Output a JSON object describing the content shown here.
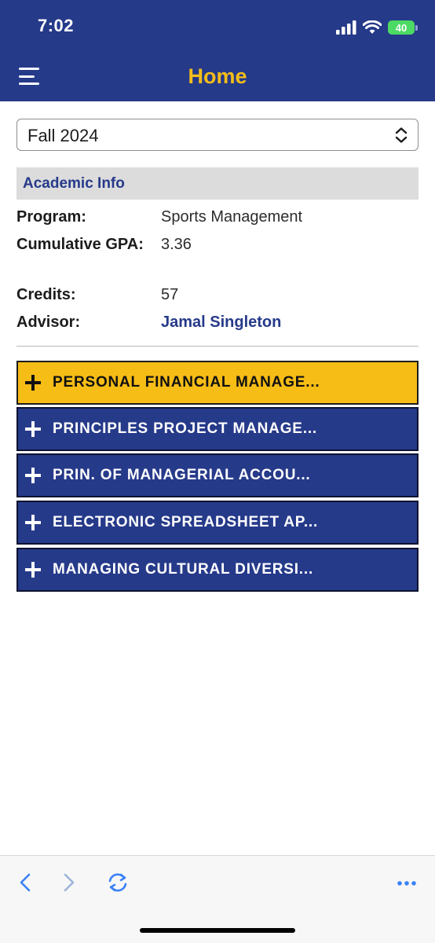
{
  "status_bar": {
    "time": "7:02",
    "battery": "40"
  },
  "header": {
    "title": "Home",
    "menu_icon": "hamburger-menu-icon"
  },
  "term_select": {
    "selected": "Fall 2024",
    "icon": "up-down-chevron-icon"
  },
  "academic_info": {
    "heading": "Academic Info",
    "rows": [
      {
        "label": "Program:",
        "value": "Sports Management"
      },
      {
        "label": "Cumulative GPA:",
        "value": "3.36"
      },
      {
        "label": "Credits:",
        "value": "57"
      },
      {
        "label": "Advisor:",
        "value": "Jamal Singleton"
      }
    ]
  },
  "courses": [
    {
      "name": "PERSONAL FINANCIAL MANAGE...",
      "active": true
    },
    {
      "name": "PRINCIPLES PROJECT MANAGE...",
      "active": false
    },
    {
      "name": "PRIN. OF MANAGERIAL ACCOU...",
      "active": false
    },
    {
      "name": "ELECTRONIC SPREADSHEET AP...",
      "active": false
    },
    {
      "name": "MANAGING CULTURAL DIVERSI...",
      "active": false
    }
  ],
  "bottom_toolbar": {
    "icons": [
      "back-arrow-icon",
      "forward-arrow-icon",
      "refresh-icon",
      "more-icon"
    ]
  },
  "colors": {
    "header_bg": "#263a8a",
    "title": "#f4bd1a",
    "active_course": "#f6bd16",
    "course_bg": "#263a8a"
  }
}
